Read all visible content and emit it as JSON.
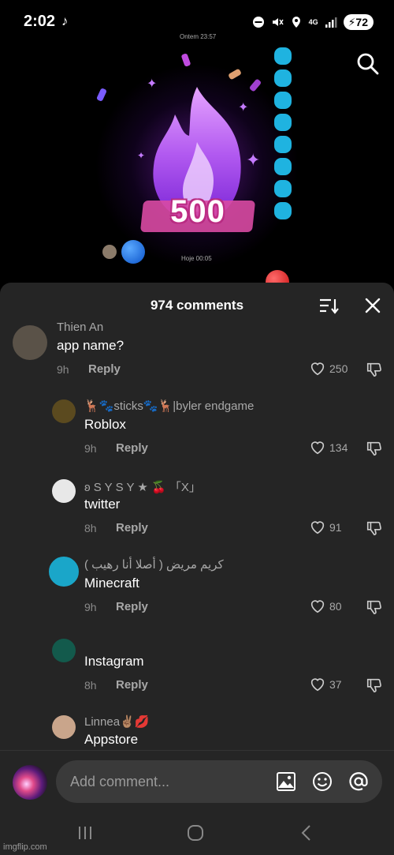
{
  "status_bar": {
    "time": "2:02",
    "network": "4G",
    "battery": "72"
  },
  "video": {
    "streak_number": "500",
    "top_caption": "Ontem 23:57",
    "caption": "Hoje 00:05"
  },
  "comments_sheet": {
    "count_label": "974 comments",
    "comments": [
      {
        "user": "Thien An",
        "text": "app name?",
        "time": "9h",
        "reply_label": "Reply",
        "likes": "250",
        "avatar_color": "#5a5248"
      },
      {
        "user": "🦌🐾sticks🐾🦌|byler endgame",
        "text": "Roblox",
        "time": "9h",
        "reply_label": "Reply",
        "likes": "134",
        "avatar_color": "#5b4a1f"
      },
      {
        "user": "ʚ S Y S Y ★ 🍒 「X」",
        "text": "twitter",
        "time": "8h",
        "reply_label": "Reply",
        "likes": "91",
        "avatar_color": "#e8e8e8"
      },
      {
        "user": "( كريم مريض ( أصلا أنا رهيب",
        "text": "Minecraft",
        "time": "9h",
        "reply_label": "Reply",
        "likes": "80",
        "avatar_color": "#1aa6c9"
      },
      {
        "user": "",
        "text": "Instagram",
        "time": "8h",
        "reply_label": "Reply",
        "likes": "37",
        "avatar_color": "#135a4c"
      },
      {
        "user": "Linnea✌🏽💋",
        "text": "Appstore",
        "time": "",
        "reply_label": "",
        "likes": "",
        "avatar_color": "#c9a58b"
      }
    ]
  },
  "input": {
    "placeholder": "Add comment..."
  },
  "watermark": "imgflip.com",
  "colors": {
    "sheet_bg": "#252525",
    "input_bg": "#3a3a3a",
    "streak_bubble": "#1fb3e0",
    "flame_purple": "#a23bf0"
  }
}
